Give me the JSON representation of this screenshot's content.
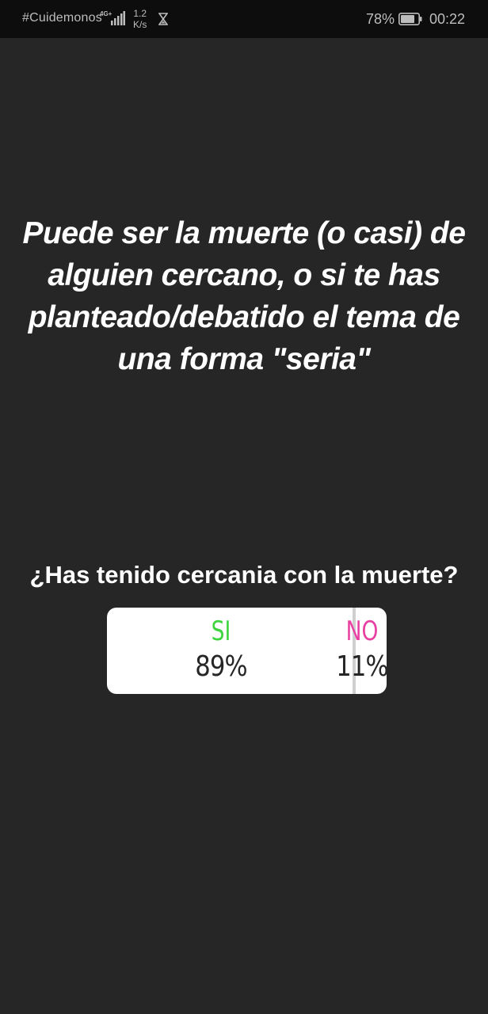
{
  "status_bar": {
    "carrier": "#Cuidemonos",
    "network_type": "4G+",
    "speed_value": "1.2",
    "speed_unit": "K/s",
    "battery_percent": "78%",
    "time": "00:22"
  },
  "story": {
    "text": "Puede ser la muerte (o casi) de alguien cercano, o si te has planteado/debatido el tema de una forma \"seria\""
  },
  "poll": {
    "question": "¿Has tenido cercania con la muerte?",
    "options": [
      {
        "label": "SI",
        "percent": "89%",
        "value": 89,
        "color": "#3ed43e"
      },
      {
        "label": "NO",
        "percent": "11%",
        "value": 11,
        "color": "#e83fa2"
      }
    ]
  },
  "colors": {
    "background": "#262626",
    "status_bar": "#0d0d0d",
    "card": "#ffffff"
  }
}
